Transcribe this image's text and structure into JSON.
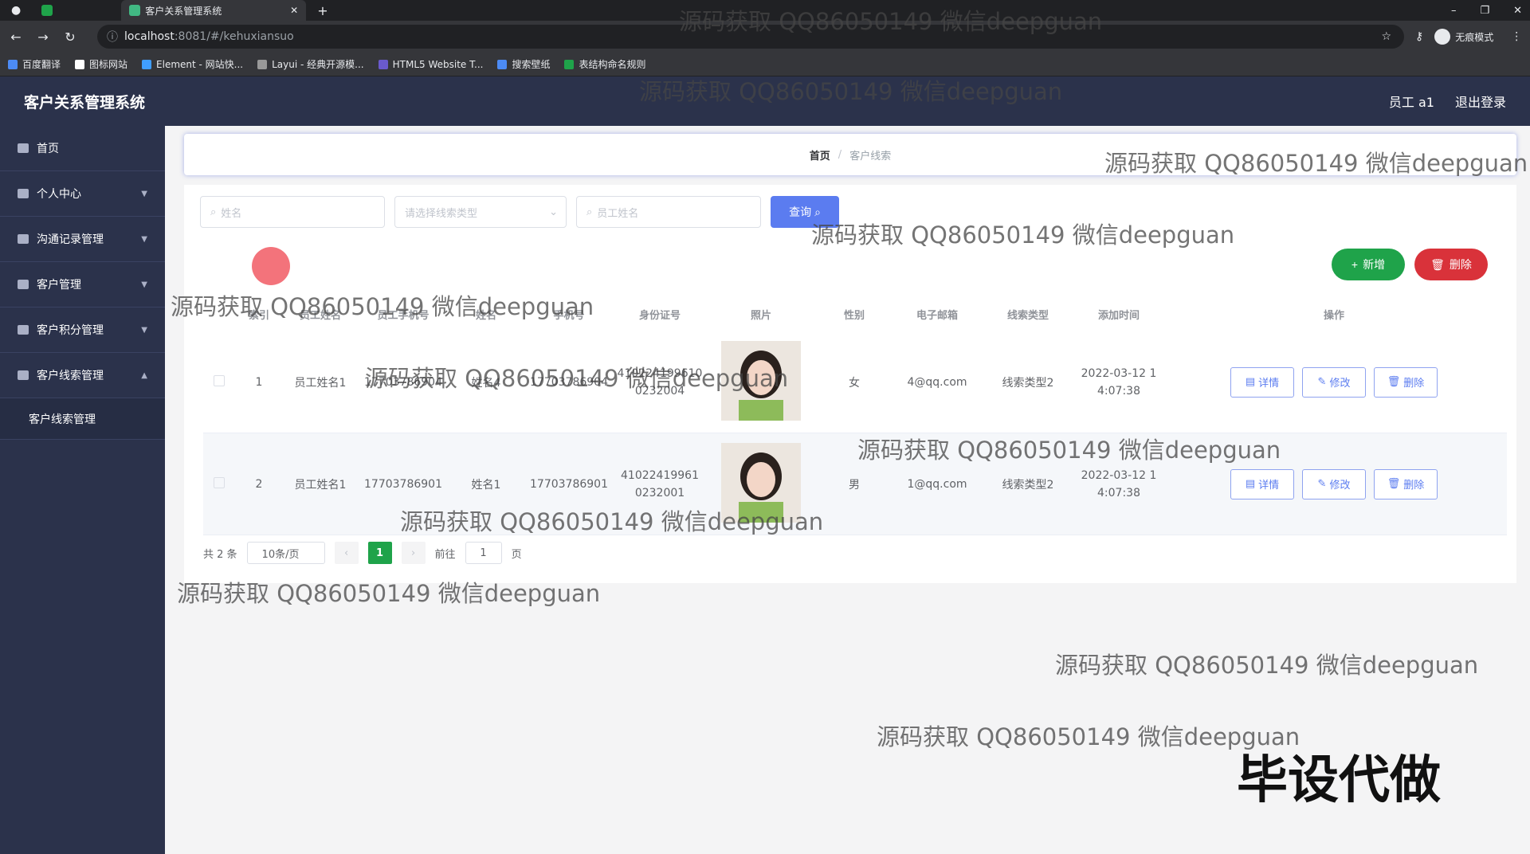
{
  "browser": {
    "tab_title": "客户关系管理系统",
    "url_host": "localhost",
    "url_path": ":8081/#/kehuxiansuo",
    "profile_label": "无痕模式",
    "bookmarks": [
      "百度翻译",
      "图标网站",
      "Element - 网站快...",
      "Layui - 经典开源模...",
      "HTML5 Website T...",
      "搜索壁纸",
      "表结构命名规则"
    ]
  },
  "header": {
    "app_title": "客户关系管理系统",
    "user_label": "员工 a1",
    "logout_label": "退出登录"
  },
  "sidebar": {
    "items": [
      {
        "label": "首页"
      },
      {
        "label": "个人中心"
      },
      {
        "label": "沟通记录管理"
      },
      {
        "label": "客户管理"
      },
      {
        "label": "客户积分管理"
      },
      {
        "label": "客户线索管理"
      }
    ],
    "submenu": "客户线索管理"
  },
  "breadcrumb": {
    "home": "首页",
    "current": "客户线索"
  },
  "search": {
    "name_placeholder": "姓名",
    "type_placeholder": "请选择线索类型",
    "staff_placeholder": "员工姓名",
    "query_label": "查询"
  },
  "actions": {
    "add_label": "新增",
    "delete_label": "删除"
  },
  "table": {
    "headers": [
      "索引",
      "员工姓名",
      "员工手机号",
      "姓名",
      "手机号",
      "身份证号",
      "照片",
      "性别",
      "电子邮箱",
      "线索类型",
      "添加时间",
      "操作"
    ],
    "rows": [
      {
        "index": "1",
        "staff_name": "员工姓名1",
        "staff_phone": "17703786904",
        "name": "姓名4",
        "phone": "17703786904",
        "id_line1": "410224199610",
        "id_line2": "0232004",
        "gender": "女",
        "email": "4@qq.com",
        "type": "线索类型2",
        "time_line1": "2022-03-12 1",
        "time_line2": "4:07:38"
      },
      {
        "index": "2",
        "staff_name": "员工姓名1",
        "staff_phone": "17703786901",
        "name": "姓名1",
        "phone": "17703786901",
        "id_line1": "41022419961",
        "id_line2": "0232001",
        "gender": "男",
        "email": "1@qq.com",
        "type": "线索类型2",
        "time_line1": "2022-03-12 1",
        "time_line2": "4:07:38"
      }
    ],
    "op_detail": "详情",
    "op_edit": "修改",
    "op_delete": "删除"
  },
  "pagination": {
    "total": "共 2 条",
    "page_size": "10条/页",
    "current_page": "1",
    "goto_prefix": "前往",
    "goto_value": "1",
    "goto_suffix": "页"
  },
  "watermark": {
    "text": "源码获取 QQ86050149 微信deepguan",
    "stamp": "毕设代做"
  }
}
